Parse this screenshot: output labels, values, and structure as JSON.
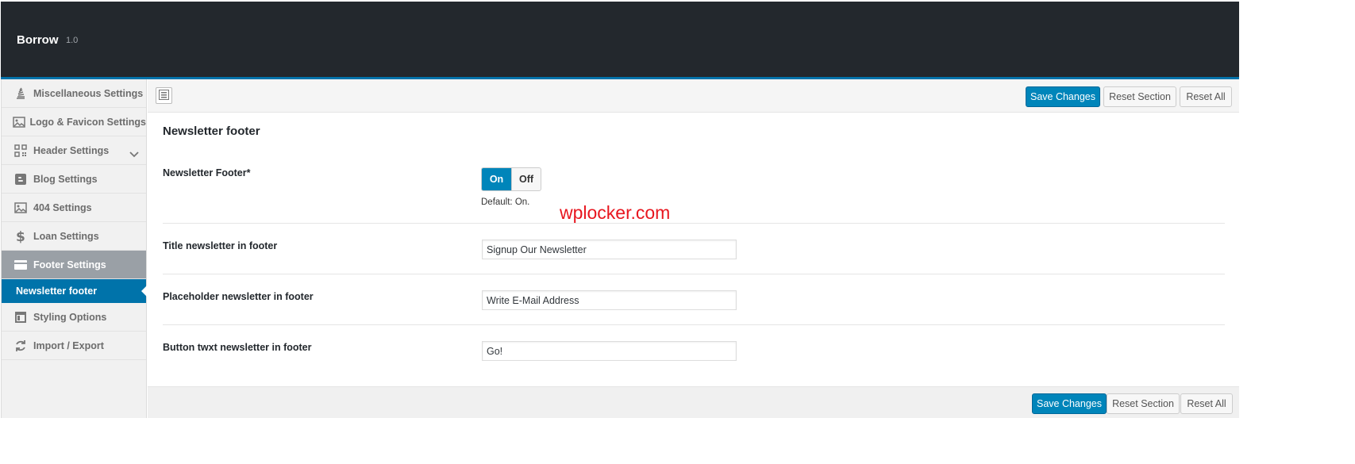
{
  "app": {
    "name": "Borrow",
    "version": "1.0"
  },
  "sidebar": {
    "items": [
      {
        "label": "Miscellaneous Settings",
        "icon": "stack-icon"
      },
      {
        "label": "Logo & Favicon Settings",
        "icon": "image-icon"
      },
      {
        "label": "Header Settings",
        "icon": "qrcode-icon"
      },
      {
        "label": "Blog Settings",
        "icon": "blogger-icon"
      },
      {
        "label": "404 Settings",
        "icon": "image-icon"
      },
      {
        "label": "Loan Settings",
        "icon": "dollar-icon"
      },
      {
        "label": "Footer Settings",
        "icon": "credit-card-icon"
      },
      {
        "label": "Newsletter footer",
        "icon": ""
      },
      {
        "label": "Styling Options",
        "icon": "window-icon"
      },
      {
        "label": "Import / Export",
        "icon": "refresh-icon"
      }
    ]
  },
  "toolbar": {
    "save_label": "Save Changes",
    "reset_section_label": "Reset Section",
    "reset_all_label": "Reset All"
  },
  "section": {
    "title": "Newsletter footer",
    "switch_field": {
      "label": "Newsletter Footer*",
      "on_label": "On",
      "off_label": "Off",
      "default_note": "Default: On."
    },
    "fields": [
      {
        "label": "Title newsletter in footer",
        "value": "Signup Our Newsletter"
      },
      {
        "label": "Placeholder newsletter in footer",
        "value": "Write E-Mail Address"
      },
      {
        "label": "Button twxt newsletter in footer",
        "value": "Go!"
      }
    ]
  },
  "watermark": "wplocker.com",
  "colors": {
    "accent": "#0085ba",
    "header_bg": "#23282d",
    "active_nav": "#9aa0a6"
  }
}
